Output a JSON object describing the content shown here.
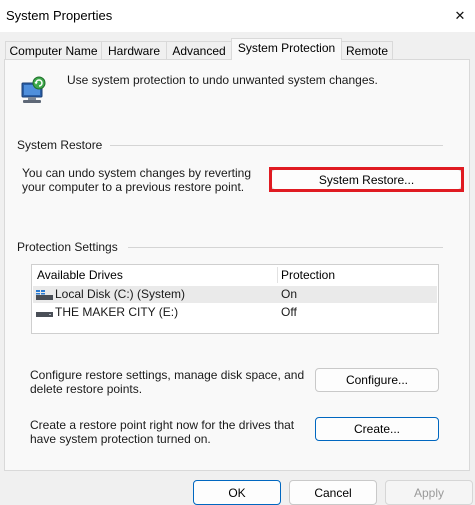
{
  "window": {
    "title": "System Properties",
    "close_glyph": "✕"
  },
  "tabs": [
    {
      "label": "Computer Name",
      "active": false
    },
    {
      "label": "Hardware",
      "active": false
    },
    {
      "label": "Advanced",
      "active": false
    },
    {
      "label": "System Protection",
      "active": true
    },
    {
      "label": "Remote",
      "active": false
    }
  ],
  "intro": {
    "icon": "system-protection-icon",
    "text": "Use system protection to undo unwanted system changes."
  },
  "system_restore": {
    "group_label": "System Restore",
    "description": "You can undo system changes by reverting your computer to a previous restore point.",
    "button_label": "System Restore..."
  },
  "protection": {
    "group_label": "Protection Settings",
    "columns": [
      "Available Drives",
      "Protection"
    ],
    "drives": [
      {
        "name": "Local Disk (C:) (System)",
        "protection": "On",
        "icon": "system-drive-icon",
        "selected": true
      },
      {
        "name": "THE MAKER CITY (E:)",
        "protection": "Off",
        "icon": "drive-icon",
        "selected": false
      }
    ],
    "configure_text": "Configure restore settings, manage disk space, and delete restore points.",
    "configure_label": "Configure...",
    "create_text": "Create a restore point right now for the drives that have system protection turned on.",
    "create_label": "Create..."
  },
  "footer": {
    "ok_label": "OK",
    "cancel_label": "Cancel",
    "apply_label": "Apply"
  },
  "colors": {
    "accent": "#0067c0",
    "highlight": "#e01b22",
    "drive_blue": "#2b7cd3"
  }
}
